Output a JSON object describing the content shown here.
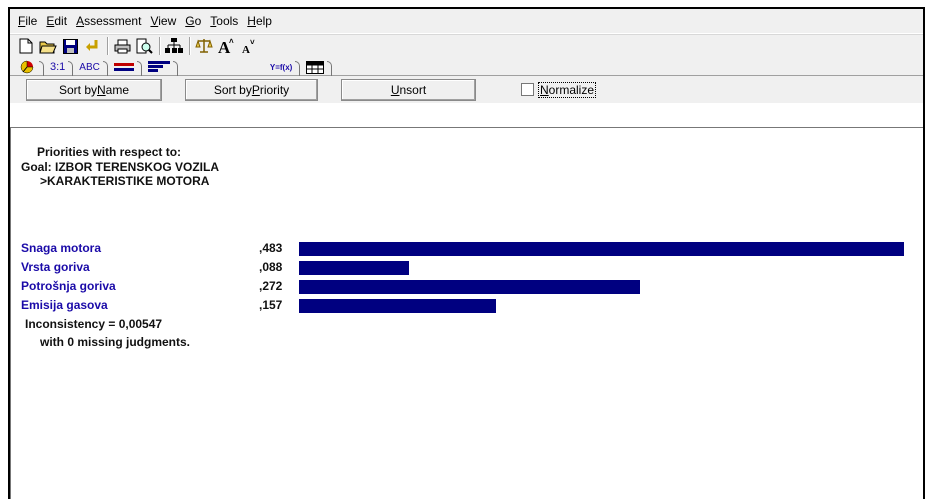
{
  "menu": {
    "items": [
      {
        "u": "F",
        "rest": "ile"
      },
      {
        "u": "E",
        "rest": "dit"
      },
      {
        "u": "A",
        "rest": "ssessment"
      },
      {
        "u": "V",
        "rest": "iew"
      },
      {
        "u": "G",
        "rest": "o"
      },
      {
        "u": "T",
        "rest": "ools"
      },
      {
        "u": "H",
        "rest": "elp"
      }
    ]
  },
  "tabs": {
    "ratio": "3:1",
    "verbal": "ABC",
    "formula": "Y=f(x)"
  },
  "buttons": {
    "sort_name": {
      "pre": "Sort by ",
      "u": "N",
      "post": "ame"
    },
    "sort_priority": {
      "pre": "Sort by ",
      "u": "P",
      "post": "riority"
    },
    "unsort": {
      "pre": "",
      "u": "U",
      "post": "nsort"
    },
    "normalize": {
      "pre": "",
      "u": "N",
      "post": "ormalize"
    }
  },
  "report": {
    "heading": "Priorities with respect to:",
    "goal": "Goal: IZBOR TERENSKOG VOZILA",
    "node": ">KARAKTERISTIKE MOTORA",
    "rows": [
      {
        "name": "Snaga motora",
        "value_label": ",483",
        "value": 0.483
      },
      {
        "name": "Vrsta goriva",
        "value_label": ",088",
        "value": 0.088
      },
      {
        "name": "Potrošnja goriva",
        "value_label": ",272",
        "value": 0.272
      },
      {
        "name": "Emisija gasova",
        "value_label": ",157",
        "value": 0.157
      }
    ],
    "inconsistency": "Inconsistency = 0,00547",
    "missing": "with 0  missing judgments."
  },
  "colors": {
    "bar": "#000080",
    "label": "#1a0aa8"
  }
}
